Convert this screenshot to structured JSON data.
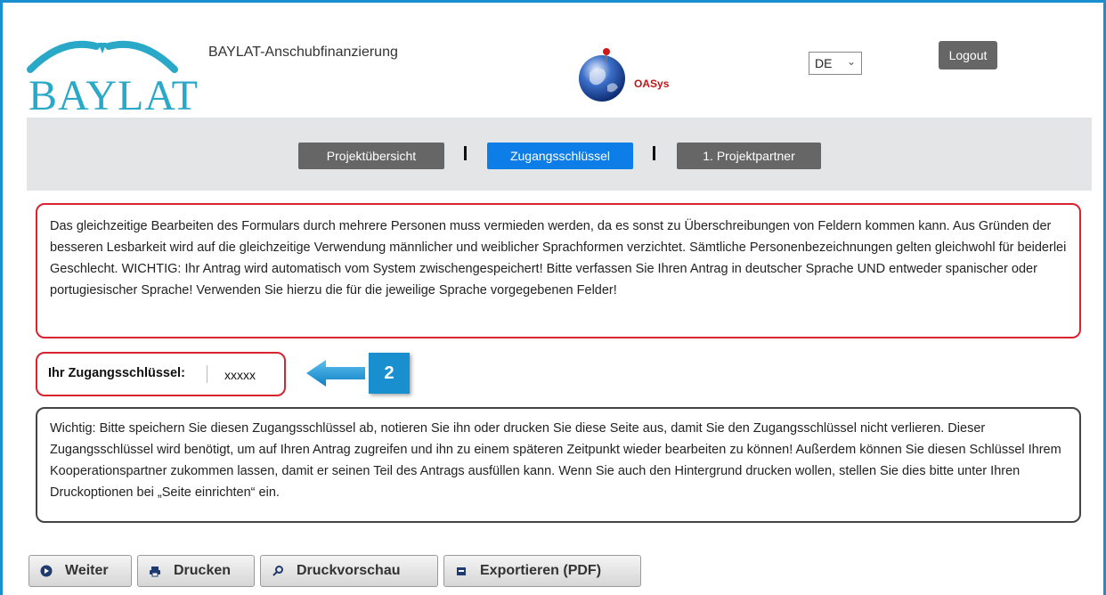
{
  "header": {
    "logo_text": "BAYLAT",
    "app_title": "BAYLAT-Anschubfinanzierung",
    "oasys_logo": {
      "main": "OASys",
      "accent_letter": "A"
    },
    "language": {
      "selected": "DE"
    },
    "logout_label": "Logout"
  },
  "nav": {
    "tabs": [
      {
        "label": "Projektübersicht",
        "active": false
      },
      {
        "label": "Zugangsschlüssel",
        "active": true
      },
      {
        "label": "1. Projektpartner",
        "active": false
      }
    ],
    "separator": "|"
  },
  "info_text": "Das gleichzeitige Bearbeiten des Formulars durch mehrere Personen muss vermieden werden, da es sonst zu Überschreibungen von Feldern kommen kann. Aus Gründen der besseren Lesbarkeit wird auf die gleichzeitige Verwendung männlicher und weiblicher Sprachformen verzichtet. Sämtliche Personenbezeichnungen gelten gleichwohl für beiderlei Geschlecht. WICHTIG: Ihr Antrag wird automatisch vom System zwischengespeichert! Bitte verfassen Sie Ihren Antrag in deutscher Sprache UND entweder spanischer oder portugiesischer Sprache! Verwenden Sie hierzu die für die jeweilige Sprache vorgegebenen Felder!",
  "access_key": {
    "label": "Ihr Zugangsschlüssel:",
    "value": "xxxxx"
  },
  "annotation": {
    "number": "2"
  },
  "note_text": "Wichtig: Bitte speichern Sie diesen Zugangsschlüssel ab, notieren Sie ihn oder drucken Sie diese Seite aus, damit Sie den Zugangsschlüssel nicht verlieren. Dieser Zugangsschlüssel wird benötigt, um auf Ihren Antrag zugreifen und ihn zu einem späteren Zeitpunkt wieder bearbeiten zu können! Außerdem können Sie diesen Schlüssel Ihrem Kooperationspartner zukommen lassen, damit er seinen Teil des Antrags ausfüllen kann. Wenn Sie auch den Hintergrund drucken wollen, stellen Sie dies bitte unter Ihren Druckoptionen bei „Seite einrichten“ ein.",
  "buttons": [
    {
      "label": "Weiter",
      "icon": "play-circle-icon"
    },
    {
      "label": "Drucken",
      "icon": "print-icon"
    },
    {
      "label": "Druckvorschau",
      "icon": "search-icon"
    },
    {
      "label": "Exportieren (PDF)",
      "icon": "export-icon"
    }
  ],
  "colors": {
    "accent_blue": "#1a8fd0",
    "active_tab": "#0d7ee8",
    "inactive_tab": "#666666",
    "warning_border": "#d9232e",
    "nav_bg": "#e4e5e7",
    "logo_teal": "#2aa8c8"
  }
}
